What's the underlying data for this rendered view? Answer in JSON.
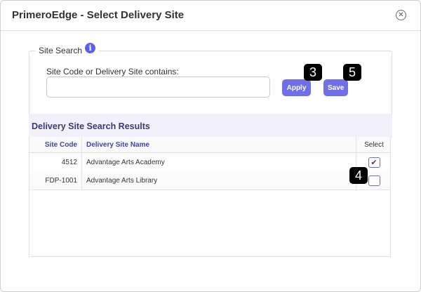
{
  "dialog": {
    "title": "PrimeroEdge - Select Delivery Site",
    "close_glyph": "✕"
  },
  "search": {
    "legend": "Site Search",
    "info_glyph": "i",
    "label": "Site Code or Delivery Site contains:",
    "value": "",
    "placeholder": ""
  },
  "buttons": {
    "apply": "Apply",
    "save": "Save"
  },
  "steps": {
    "apply": "3",
    "checkbox": "4",
    "save": "5"
  },
  "results": {
    "title": "Delivery Site Search Results",
    "columns": {
      "code": "Site Code",
      "name": "Delivery Site Name",
      "select": "Select"
    },
    "rows": [
      {
        "code": "4512",
        "name": "Advantage Arts Academy",
        "selected": true,
        "check_glyph": "✔"
      },
      {
        "code": "FDP-1001",
        "name": "Advantage Arts Library",
        "selected": false,
        "check_glyph": ""
      }
    ]
  },
  "colors": {
    "accent": "#6f6fe8",
    "info": "#5c5ff0",
    "header_text": "#3a3a78",
    "step_badge": "#000000"
  },
  "icons": [
    "close-circle-icon",
    "info-icon",
    "checkmark-icon"
  ]
}
